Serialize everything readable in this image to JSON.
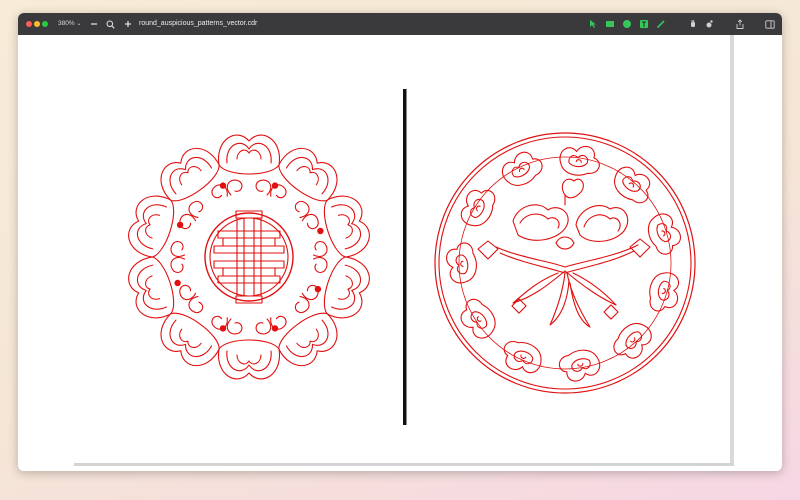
{
  "window": {
    "zoom_label": "380%",
    "zoom_out_icon": "minus",
    "zoom_in_icon": "plus",
    "search_icon": "magnifier",
    "file_name": "round_auspicious_patterns_vector.cdr"
  },
  "toolbar_icons": [
    "select-tool-icon",
    "rectangle-tool-icon",
    "ellipse-tool-icon",
    "text-tool-icon",
    "pen-tool-icon",
    "hand-tool-icon",
    "pan-tool-icon",
    "share-icon",
    "sidebar-toggle-icon"
  ],
  "colors": {
    "titlebar": "#3a3a3c",
    "pattern_red": "#e01010",
    "divider": "#111111",
    "tool_green": "#34c759"
  },
  "artwork": {
    "left": "round-shou-longevity-medallion",
    "right": "round-cloud-gourd-medallion"
  }
}
